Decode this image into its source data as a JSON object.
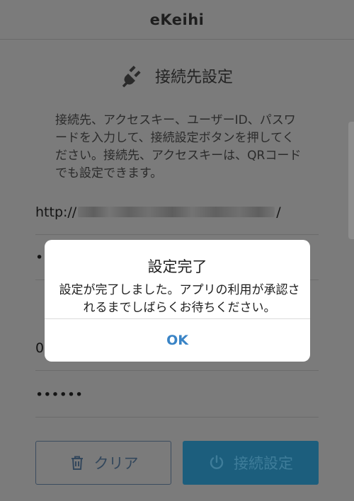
{
  "header": {
    "title": "eKeihi"
  },
  "section": {
    "icon": "plug-icon",
    "title": "接続先設定"
  },
  "instructions": "接続先、アクセスキー、ユーザーID、パスワードを入力して、接続設定ボタンを押してください。接続先、アクセスキーは、QRコードでも設定できます。",
  "fields": {
    "url_prefix": "http://",
    "url_suffix": "/",
    "access_key": "••",
    "user_id": "0",
    "password": "••••••"
  },
  "buttons": {
    "clear_icon": "trash-icon",
    "clear_label": "クリア",
    "connect_icon": "power-icon",
    "connect_label": "接続設定"
  },
  "dialog": {
    "title": "設定完了",
    "message": "設定が完了しました。アプリの利用が承認されるまでしばらくお待ちください。",
    "ok_label": "OK"
  },
  "colors": {
    "overlay": "#7b7b7b",
    "dialog_bg": "#ffffff",
    "ok_text": "#3a84c6",
    "connect_button": "#1c5e7d"
  }
}
